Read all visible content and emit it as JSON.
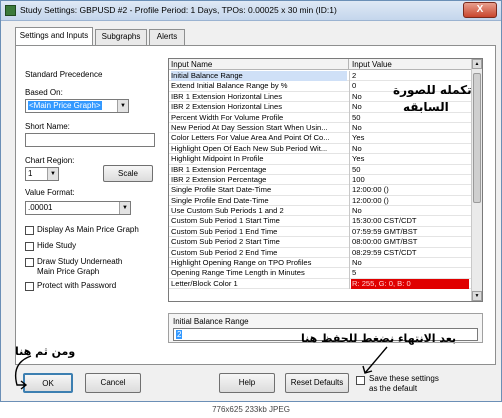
{
  "window": {
    "title": "Study Settings: GBPUSD  #2 - Profile Period: 1 Days, TPOs: 0.00025 x 30 min   (ID:1)",
    "close_label": "X"
  },
  "tabs": [
    {
      "label": "Settings and Inputs",
      "active": true
    },
    {
      "label": "Subgraphs",
      "active": false
    },
    {
      "label": "Alerts",
      "active": false
    }
  ],
  "left": {
    "standard_precedence": "Standard Precedence",
    "based_on_label": "Based On:",
    "based_on_value": "<Main Price Graph>",
    "short_name_label": "Short Name:",
    "short_name_value": "",
    "chart_region_label": "Chart Region:",
    "chart_region_value": "1",
    "scale_button": "Scale",
    "value_format_label": "Value Format:",
    "value_format_value": ".00001",
    "checkboxes": [
      {
        "label": "Display As Main Price Graph",
        "checked": false
      },
      {
        "label": "Hide Study",
        "checked": false
      },
      {
        "label": "Draw Study Underneath",
        "label2": "Main Price Graph",
        "checked": false
      },
      {
        "label": "Protect with Password",
        "checked": false
      }
    ]
  },
  "inputs": {
    "header_name": "Input Name",
    "header_value": "Input Value",
    "rows": [
      {
        "name": "Initial Balance Range",
        "value": "2"
      },
      {
        "name": "Extend Initial Balance Range by %",
        "value": "0"
      },
      {
        "name": "IBR 1 Extension Horizontal Lines",
        "value": "No"
      },
      {
        "name": "IBR 2 Extension Horizontal Lines",
        "value": "No"
      },
      {
        "name": "Percent Width For Volume Profile",
        "value": "50"
      },
      {
        "name": "New Period At Day Session Start When Usin...",
        "value": "No"
      },
      {
        "name": "Color Letters For Value Area And Point Of Co...",
        "value": "Yes"
      },
      {
        "name": "Highlight Open Of Each New Sub Period Wit...",
        "value": "No"
      },
      {
        "name": "Highlight Midpoint In Profile",
        "value": "Yes"
      },
      {
        "name": "IBR 1 Extension Percentage",
        "value": "50"
      },
      {
        "name": "IBR 2 Extension Percentage",
        "value": "100"
      },
      {
        "name": "Single Profile Start Date-Time",
        "value": "12:00:00 ()"
      },
      {
        "name": "Single Profile End Date-Time",
        "value": "12:00:00 ()"
      },
      {
        "name": "Use Custom Sub Periods 1 and 2",
        "value": "No"
      },
      {
        "name": "Custom Sub Period 1 Start Time",
        "value": "15:30:00 CST/CDT"
      },
      {
        "name": "Custom Sub Period 1 End Time",
        "value": "07:59:59 GMT/BST"
      },
      {
        "name": "Custom Sub Period 2 Start Time",
        "value": "08:00:00 GMT/BST"
      },
      {
        "name": "Custom Sub Period 2 End Time",
        "value": "08:29:59 CST/CDT"
      },
      {
        "name": "Highlight Opening Range on TPO Profiles",
        "value": "No"
      },
      {
        "name": "Opening Range Time Length in Minutes",
        "value": "5"
      },
      {
        "name": "Letter/Block Color 1",
        "value": "R: 255, G: 0, B: 0"
      }
    ]
  },
  "description": {
    "label": "Initial Balance Range",
    "value": "2"
  },
  "buttons": {
    "ok": "OK",
    "cancel": "Cancel",
    "help": "Help",
    "reset": "Reset Defaults",
    "save_default_line1": "Save these settings",
    "save_default_line2": "as the default"
  },
  "annotations": {
    "top_line1": "تكمله للصورة",
    "top_line2": "السابقه",
    "save_hint": "بعد الانتهاء نضغط للحفظ هنا",
    "ok_hint": "ومن ثم هنا"
  },
  "statusbar": "776x625  233kb  JPEG",
  "colors": {
    "accent_red": "#e00000",
    "selection_blue": "#3399ff"
  }
}
